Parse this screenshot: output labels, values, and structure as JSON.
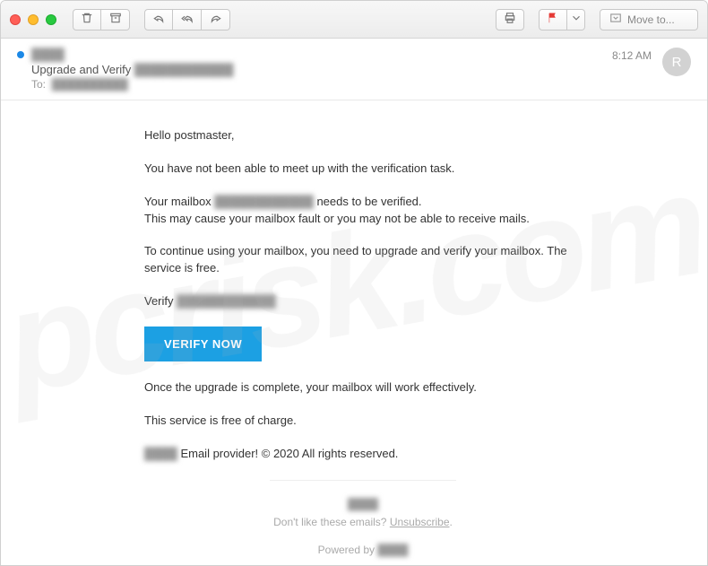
{
  "toolbar": {
    "move_label": "Move to..."
  },
  "header": {
    "sender": "████",
    "subject_prefix": "Upgrade and Verify ",
    "subject_blur": "████████████",
    "to_label": "To:",
    "to_value": "██████████",
    "time": "8:12 AM",
    "avatar_initial": "R"
  },
  "body": {
    "greeting": "Hello postmaster,",
    "p1": "You have not been able to meet up with the verification task.",
    "p2a": "Your mailbox ",
    "p2_blur": "████████████",
    "p2b": " needs to be verified.",
    "p3": "This may cause your mailbox fault or you may not be able to receive mails.",
    "p4": "To continue using your mailbox, you need to upgrade and verify your mailbox. The service is free.",
    "p5a": "Verify ",
    "p5_blur": "████████████",
    "cta": "VERIFY NOW",
    "p6": "Once the upgrade is complete, your mailbox will work effectively.",
    "p7": "This service is free of charge.",
    "p8_blur": "████",
    "p8": " Email provider! © 2020 All rights reserved."
  },
  "footer": {
    "line1_blur": "████",
    "line2a": "Don't like these emails? ",
    "line2_link": "Unsubscribe",
    "line2b": ".",
    "line3a": "Powered by ",
    "line3_blur": "████"
  },
  "watermark": "pcrisk.com"
}
